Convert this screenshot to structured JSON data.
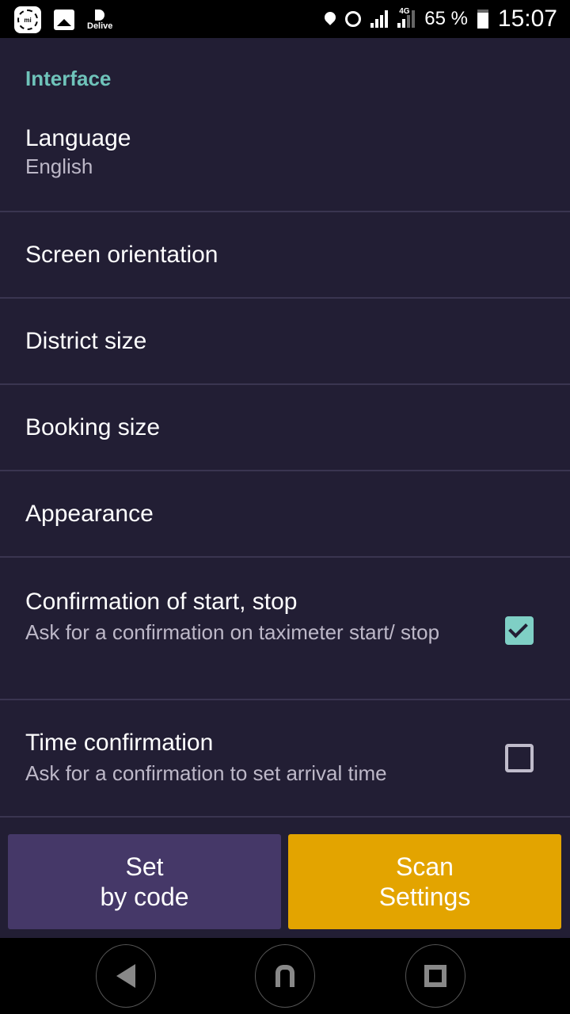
{
  "status_bar": {
    "notification_icons": [
      "mi-icon",
      "gallery-icon",
      "delive-icon"
    ],
    "delive_label": "Delive",
    "network_type": "4G",
    "battery_percent": "65 %",
    "time": "15:07",
    "status_icons": [
      "location-icon",
      "alarm-icon",
      "signal-icon",
      "signal-4g-icon",
      "battery-icon"
    ]
  },
  "section": {
    "title": "Interface",
    "accent_color": "#6fc3ba"
  },
  "preferences": [
    {
      "title": "Language",
      "summary": "English"
    },
    {
      "title": "Screen orientation"
    },
    {
      "title": "District size"
    },
    {
      "title": "Booking size"
    },
    {
      "title": "Appearance"
    },
    {
      "title": "Confirmation of start, stop",
      "summary": "Ask for a confirmation on taximeter start/ stop",
      "checked": true
    },
    {
      "title": "Time confirmation",
      "summary": "Ask for a confirmation to set arrival time",
      "checked": false
    }
  ],
  "buttons": {
    "set_by_code": {
      "line1": "Set",
      "line2": "by code",
      "color": "#453868"
    },
    "scan_settings": {
      "line1": "Scan",
      "line2": "Settings",
      "color": "#e3a400"
    }
  },
  "nav_bar": {
    "icons": [
      "back-icon",
      "home-icon",
      "recents-icon"
    ]
  }
}
